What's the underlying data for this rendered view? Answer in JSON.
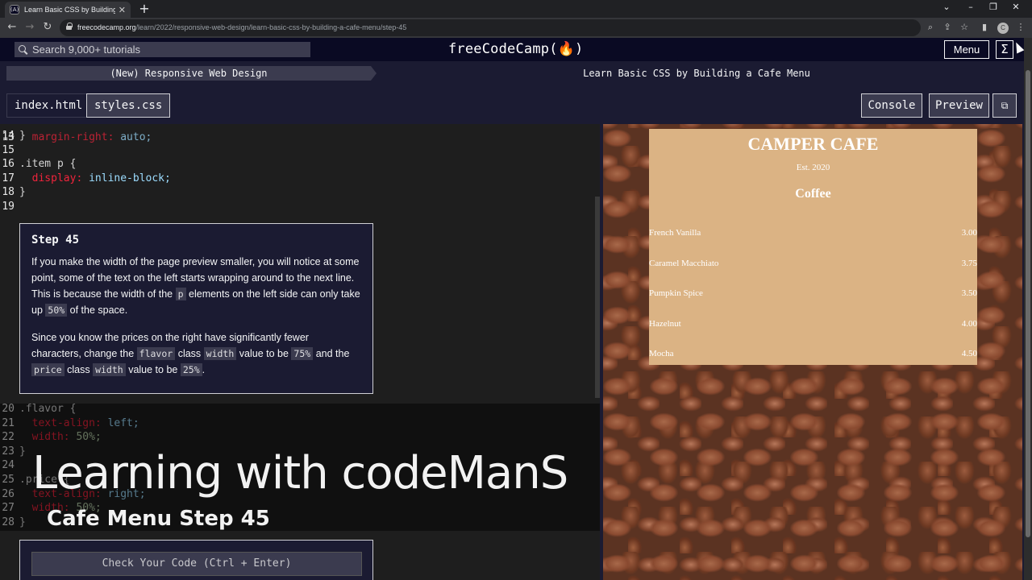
{
  "browser": {
    "tab_title": "Learn Basic CSS by Building a Ca",
    "favicon_text": "(A)",
    "url_host": "freecodecamp.org",
    "url_path": "/learn/2022/responsive-web-design/learn-basic-css-by-building-a-cafe-menu/step-45",
    "profile_initial": "C"
  },
  "nav": {
    "search_placeholder": "Search 9,000+ tutorials",
    "brand": "freeCodeCamp(🔥)",
    "menu_label": "Menu",
    "sigma": "Σ"
  },
  "breadcrumbs": {
    "superblock": "(New) Responsive Web Design",
    "block": "Learn Basic CSS by Building a Cafe Menu"
  },
  "toolbar": {
    "files": [
      "index.html",
      "styles.css"
    ],
    "console_label": "Console",
    "preview_label": "Preview"
  },
  "editor": {
    "top_lines": [
      {
        "n": "14",
        "code": "}"
      },
      {
        "n": "15",
        "code": ""
      },
      {
        "n": "16",
        "code": ".item p {"
      },
      {
        "n": "17",
        "prop": "display:",
        "value": "inline-block;"
      },
      {
        "n": "18",
        "code": "}"
      },
      {
        "n": "19",
        "code": ""
      }
    ],
    "bottom_lines": [
      {
        "n": "20",
        "code": ".flavor {"
      },
      {
        "n": "21",
        "prop": "text-align:",
        "value": "left;"
      },
      {
        "n": "22",
        "prop": "width:",
        "value": "50%;"
      },
      {
        "n": "23",
        "code": "}"
      },
      {
        "n": "24",
        "code": ""
      },
      {
        "n": "25",
        "code": ".price {"
      },
      {
        "n": "26",
        "prop": "text-align:",
        "value": "right;"
      },
      {
        "n": "27",
        "prop": "width:",
        "value": "50%;"
      },
      {
        "n": "28",
        "code": "}"
      }
    ]
  },
  "step": {
    "title": "Step 45",
    "p1_a": "If you make the width of the page preview smaller, you will notice at some point, some of the text on the left starts wrapping around to the next line. This is because the width of the",
    "p1_code1": "p",
    "p1_b": "elements on the left side can only take up",
    "p1_code2": "50%",
    "p1_c": "of the space.",
    "p2_a": "Since you know the prices on the right have significantly fewer characters, change the",
    "p2_code1": "flavor",
    "p2_b": "class",
    "p2_code2": "width",
    "p2_c": "value to be",
    "p2_code3": "75%",
    "p2_d": "and the",
    "p2_code4": "price",
    "p2_e": "class",
    "p2_code5": "width",
    "p2_f": "value to be",
    "p2_code6": "25%",
    "p2_g": "."
  },
  "overlay": {
    "title": "Learning with codeManS",
    "subtitle": "Cafe Menu Step 45"
  },
  "check_button": "Check Your Code (Ctrl + Enter)",
  "preview": {
    "cafe_name": "CAMPER CAFE",
    "established": "Est. 2020",
    "category": "Coffee",
    "items": [
      {
        "flavor": "French Vanilla",
        "price": "3.00"
      },
      {
        "flavor": "Caramel Macchiato",
        "price": "3.75"
      },
      {
        "flavor": "Pumpkin Spice",
        "price": "3.50"
      },
      {
        "flavor": "Hazelnut",
        "price": "4.00"
      },
      {
        "flavor": "Mocha",
        "price": "4.50"
      }
    ]
  },
  "colors": {
    "fcc_dark": "#0a0a23",
    "fcc_panel": "#1b1b32",
    "fcc_gray": "#3b3b4f",
    "menu_card": "#dbb384",
    "css_property": "#f0243c"
  }
}
